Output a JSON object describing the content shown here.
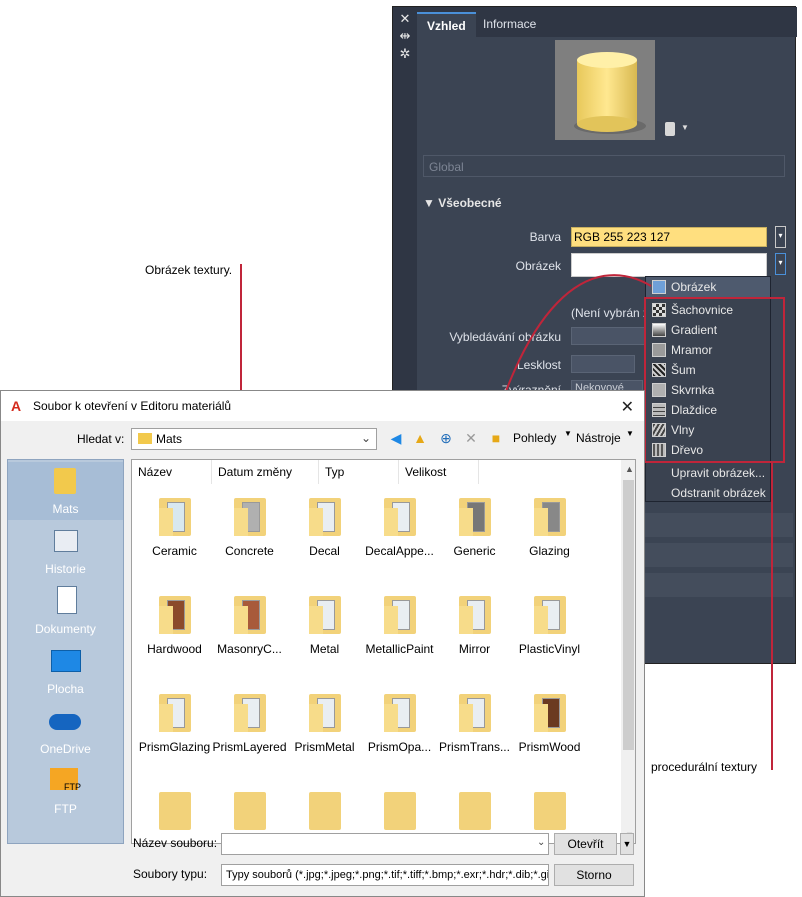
{
  "editor": {
    "tabs": [
      "Vzhled",
      "Informace"
    ],
    "global_label": "Global",
    "section_general": "Všeobecné",
    "props": {
      "color_label": "Barva",
      "color_value": "RGB 255 223 127",
      "image_label": "Obrázek",
      "no_image": "(Není vybrán ž",
      "fade_label": "Vybledávání obrázku",
      "gloss_label": "Lesklost",
      "highlights_label": "Zvýraznění",
      "highlights_value": "Nekovové"
    },
    "colors": {
      "swatch": "#ffdf7f",
      "panel": "#3b4453",
      "accent_red": "#c0253a"
    }
  },
  "popup": {
    "header": "Obrázek",
    "procedural": [
      "Šachovnice",
      "Gradient",
      "Mramor",
      "Šum",
      "Skvrnka",
      "Dlaždice",
      "Vlny",
      "Dřevo"
    ],
    "edit": "Upravit obrázek...",
    "remove": "Odstranit obrázek"
  },
  "annotations": {
    "texture_image": "Obrázek textury.",
    "procedural": "procedurální textury"
  },
  "dialog": {
    "title": "Soubor k otevření v Editoru materiálů",
    "look_in_label": "Hledat v:",
    "look_in_value": "Mats",
    "views": "Pohledy",
    "tools": "Nástroje",
    "places": [
      "Mats",
      "Historie",
      "Dokumenty",
      "Plocha",
      "OneDrive",
      "FTP"
    ],
    "ftp_badge": "FTP",
    "columns": [
      "Název",
      "Datum změny",
      "Typ",
      "Velikost"
    ],
    "files": [
      "Ceramic",
      "Concrete",
      "Decal",
      "DecalAppe...",
      "Generic",
      "Glazing",
      "Hardwood",
      "MasonryC...",
      "Metal",
      "MetallicPaint",
      "Mirror",
      "PlasticVinyl",
      "PrismGlazing",
      "PrismLayered",
      "PrismMetal",
      "PrismOpa...",
      "PrismTrans...",
      "PrismWood"
    ],
    "file_name_label": "Název souboru:",
    "file_name_value": "",
    "file_type_label": "Soubory typu:",
    "file_type_value": "Typy souborů  (*.jpg;*.jpeg;*.png;*.tif;*.tiff;*.bmp;*.exr;*.hdr;*.dib;*.gif",
    "open": "Otevřít",
    "cancel": "Storno"
  }
}
